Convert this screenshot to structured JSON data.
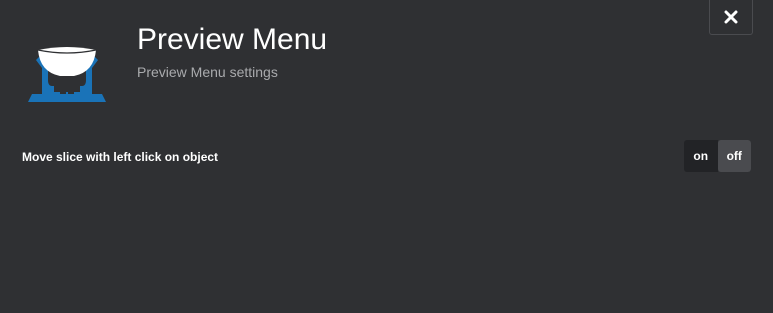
{
  "dialog": {
    "title": "Preview Menu",
    "subtitle": "Preview Menu settings",
    "close_icon": "close-icon",
    "logo_icon": "printer-bed-icon"
  },
  "settings": [
    {
      "label": "Move slice with left click on object",
      "toggle": {
        "on_label": "on",
        "off_label": "off",
        "selected": "off"
      }
    }
  ],
  "colors": {
    "background": "#2f3033",
    "accent_blue": "#1a73b8",
    "toggle_selected": "#4a4b4f",
    "toggle_unselected": "#222326",
    "subtitle": "#a9aaad"
  }
}
